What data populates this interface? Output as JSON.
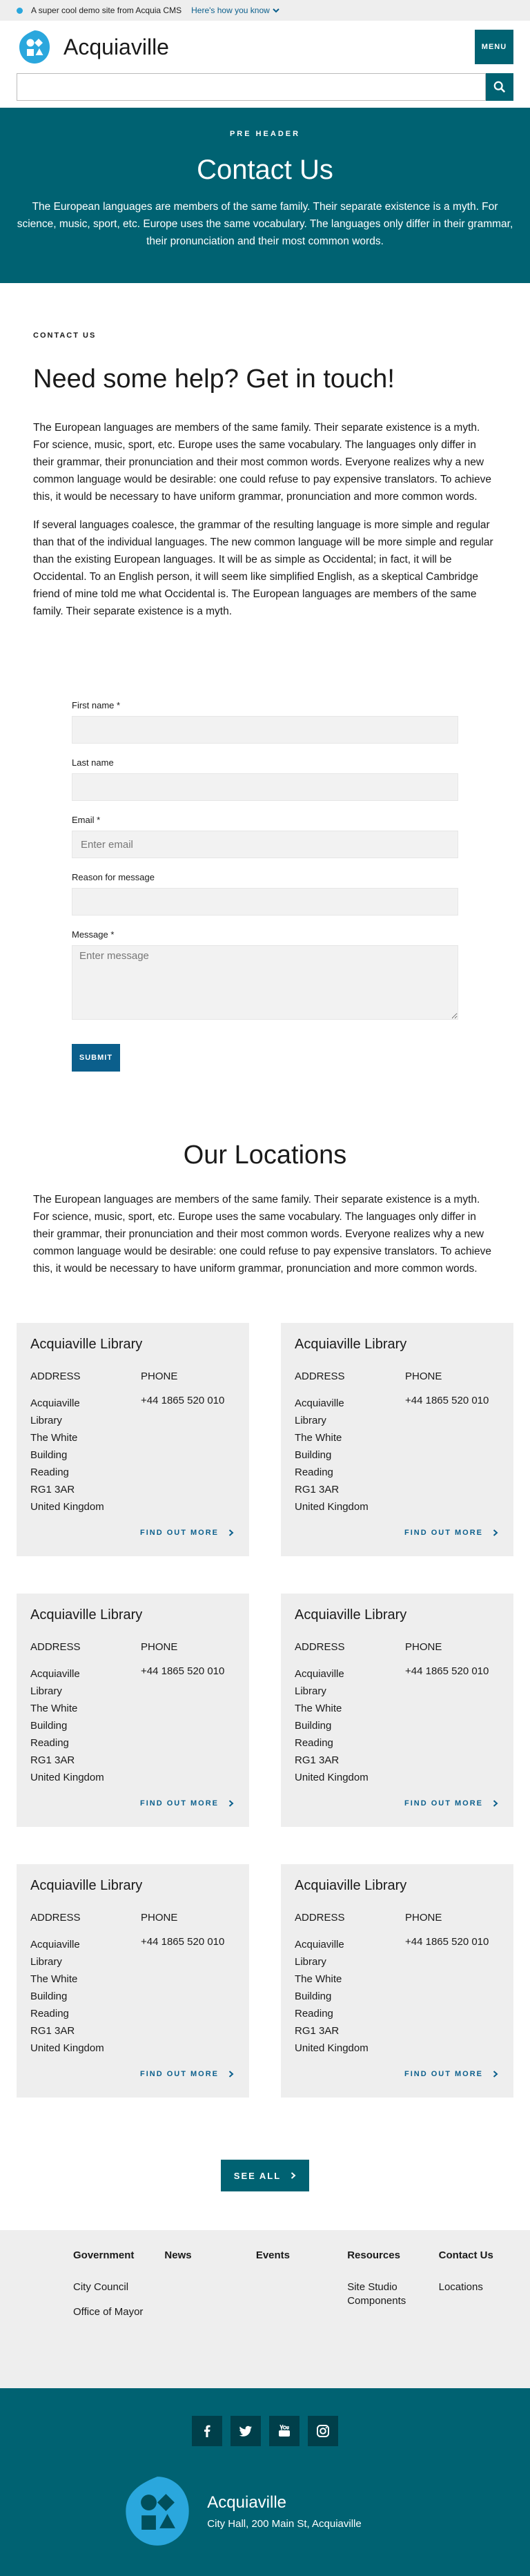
{
  "notice": {
    "message": "A super cool demo site from Acquia CMS",
    "link": "Here's how you know"
  },
  "header": {
    "brand": "Acquiaville",
    "menu_label": "MENU"
  },
  "search": {
    "placeholder": "",
    "button_label": "Search"
  },
  "hero": {
    "pre_header": "PRE HEADER",
    "title": "Contact Us",
    "text": "The European languages are members of the same family. Their separate existence is a myth. For science, music, sport, etc. Europe uses the same vocabulary. The languages only differ in their grammar, their pronunciation and their most common words."
  },
  "contact": {
    "eyebrow": "CONTACT US",
    "title": "Need some help? Get in touch!",
    "paragraphs": [
      "The European languages are members of the same family. Their separate existence is a myth. For science, music, sport, etc. Europe uses the same vocabulary. The languages only differ in their grammar, their pronunciation and their most common words. Everyone realizes why a new common language would be desirable: one could refuse to pay expensive translators. To achieve this, it would be necessary to have uniform grammar, pronunciation and more common words.",
      "If several languages coalesce, the grammar of the resulting language is more simple and regular than that of the individual languages. The new common language will be more simple and regular than the existing European languages. It will be as simple as Occidental; in fact, it will be Occidental. To an English person, it will seem like simplified English, as a skeptical Cambridge friend of mine told me what Occidental is. The European languages are members of the same family. Their separate existence is a myth."
    ]
  },
  "form": {
    "first_name_label": "First name *",
    "first_name_value": "",
    "last_name_label": "Last name",
    "last_name_value": "",
    "email_label": "Email *",
    "email_placeholder": "Enter email",
    "reason_label": "Reason for message",
    "reason_value": "",
    "message_label": "Message *",
    "message_placeholder": "Enter message",
    "submit_label": "SUBMIT"
  },
  "locations": {
    "title": "Our Locations",
    "intro": "The European languages are members of the same family. Their separate existence is a myth. For science, music, sport, etc. Europe uses the same vocabulary. The languages only differ in their grammar, their pronunciation and their most common words. Everyone realizes why a new common language would be desirable: one could refuse to pay expensive translators. To achieve this, it would be necessary to have uniform grammar, pronunciation and more common words.",
    "cards": [
      {
        "name": "Acquiaville Library",
        "address_label": "ADDRESS",
        "phone_label": "PHONE",
        "address": [
          "Acquiaville",
          "Library",
          "The White",
          "Building",
          "Reading",
          "RG1 3AR",
          "United Kingdom"
        ],
        "phone": "+44 1865 520 010",
        "link": "FIND OUT MORE"
      },
      {
        "name": "Acquiaville Library",
        "address_label": "ADDRESS",
        "phone_label": "PHONE",
        "address": [
          "Acquiaville",
          "Library",
          "The White",
          "Building",
          "Reading",
          "RG1 3AR",
          "United Kingdom"
        ],
        "phone": "+44 1865 520 010",
        "link": "FIND OUT MORE"
      },
      {
        "name": "Acquiaville Library",
        "address_label": "ADDRESS",
        "phone_label": "PHONE",
        "address": [
          "Acquiaville",
          "Library",
          "The White",
          "Building",
          "Reading",
          "RG1 3AR",
          "United Kingdom"
        ],
        "phone": "+44 1865 520 010",
        "link": "FIND OUT MORE"
      },
      {
        "name": "Acquiaville Library",
        "address_label": "ADDRESS",
        "phone_label": "PHONE",
        "address": [
          "Acquiaville",
          "Library",
          "The White",
          "Building",
          "Reading",
          "RG1 3AR",
          "United Kingdom"
        ],
        "phone": "+44 1865 520 010",
        "link": "FIND OUT MORE"
      },
      {
        "name": "Acquiaville Library",
        "address_label": "ADDRESS",
        "phone_label": "PHONE",
        "address": [
          "Acquiaville",
          "Library",
          "The White",
          "Building",
          "Reading",
          "RG1 3AR",
          "United Kingdom"
        ],
        "phone": "+44 1865 520 010",
        "link": "FIND OUT MORE"
      },
      {
        "name": "Acquiaville Library",
        "address_label": "ADDRESS",
        "phone_label": "PHONE",
        "address": [
          "Acquiaville",
          "Library",
          "The White",
          "Building",
          "Reading",
          "RG1 3AR",
          "United Kingdom"
        ],
        "phone": "+44 1865 520 010",
        "link": "FIND OUT MORE"
      }
    ],
    "see_all": "SEE ALL"
  },
  "footer_nav": {
    "columns": [
      {
        "heading": "Government",
        "links": [
          "City Council",
          "Office of Mayor"
        ]
      },
      {
        "heading": "News",
        "links": []
      },
      {
        "heading": "Events",
        "links": []
      },
      {
        "heading": "Resources",
        "links": [
          "Site Studio Components"
        ]
      },
      {
        "heading": "Contact Us",
        "links": [
          "Locations"
        ]
      }
    ]
  },
  "footer": {
    "social": [
      "facebook-icon",
      "twitter-icon",
      "youtube-icon",
      "instagram-icon"
    ],
    "brand": "Acquiaville",
    "address": "City Hall, 200 Main St, Acquiaville"
  },
  "colors": {
    "brand_teal": "#006272",
    "link_blue": "#0b5f8c",
    "logo_blue": "#2aa7dd",
    "panel_gray": "#eeeeee"
  }
}
